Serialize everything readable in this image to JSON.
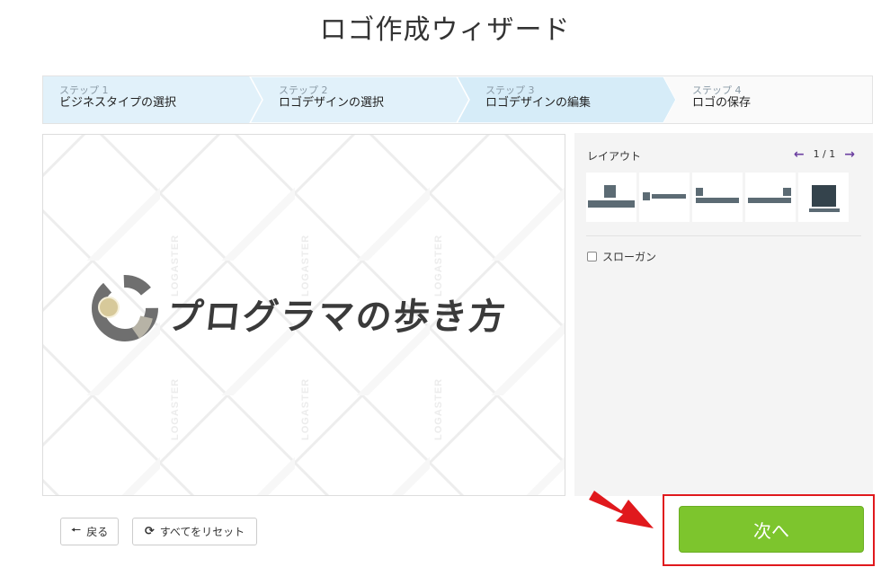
{
  "page": {
    "title": "ロゴ作成ウィザード"
  },
  "steps": [
    {
      "num": "ステップ 1",
      "label": "ビジネスタイプの選択"
    },
    {
      "num": "ステップ 2",
      "label": "ロゴデザインの選択"
    },
    {
      "num": "ステップ 3",
      "label": "ロゴデザインの編集"
    },
    {
      "num": "ステップ 4",
      "label": "ロゴの保存"
    }
  ],
  "canvas": {
    "logo_text": "プログラマの歩き方",
    "watermark": "LOGASTER"
  },
  "panel": {
    "layout_label": "レイアウト",
    "pager_text": "1 / 1",
    "prev_icon": "arrow-left-icon",
    "next_icon": "arrow-right-icon",
    "slogan_label": "スローガン"
  },
  "footer": {
    "back_label": "戻る",
    "reset_label": "すべてをリセット",
    "next_label": "次へ"
  },
  "colors": {
    "step_active": "#d6ecf8",
    "step_done": "#e1f1fa",
    "next_button": "#7dc52d",
    "highlight_frame": "#e0191d",
    "pager_arrow": "#6b3fa0"
  }
}
